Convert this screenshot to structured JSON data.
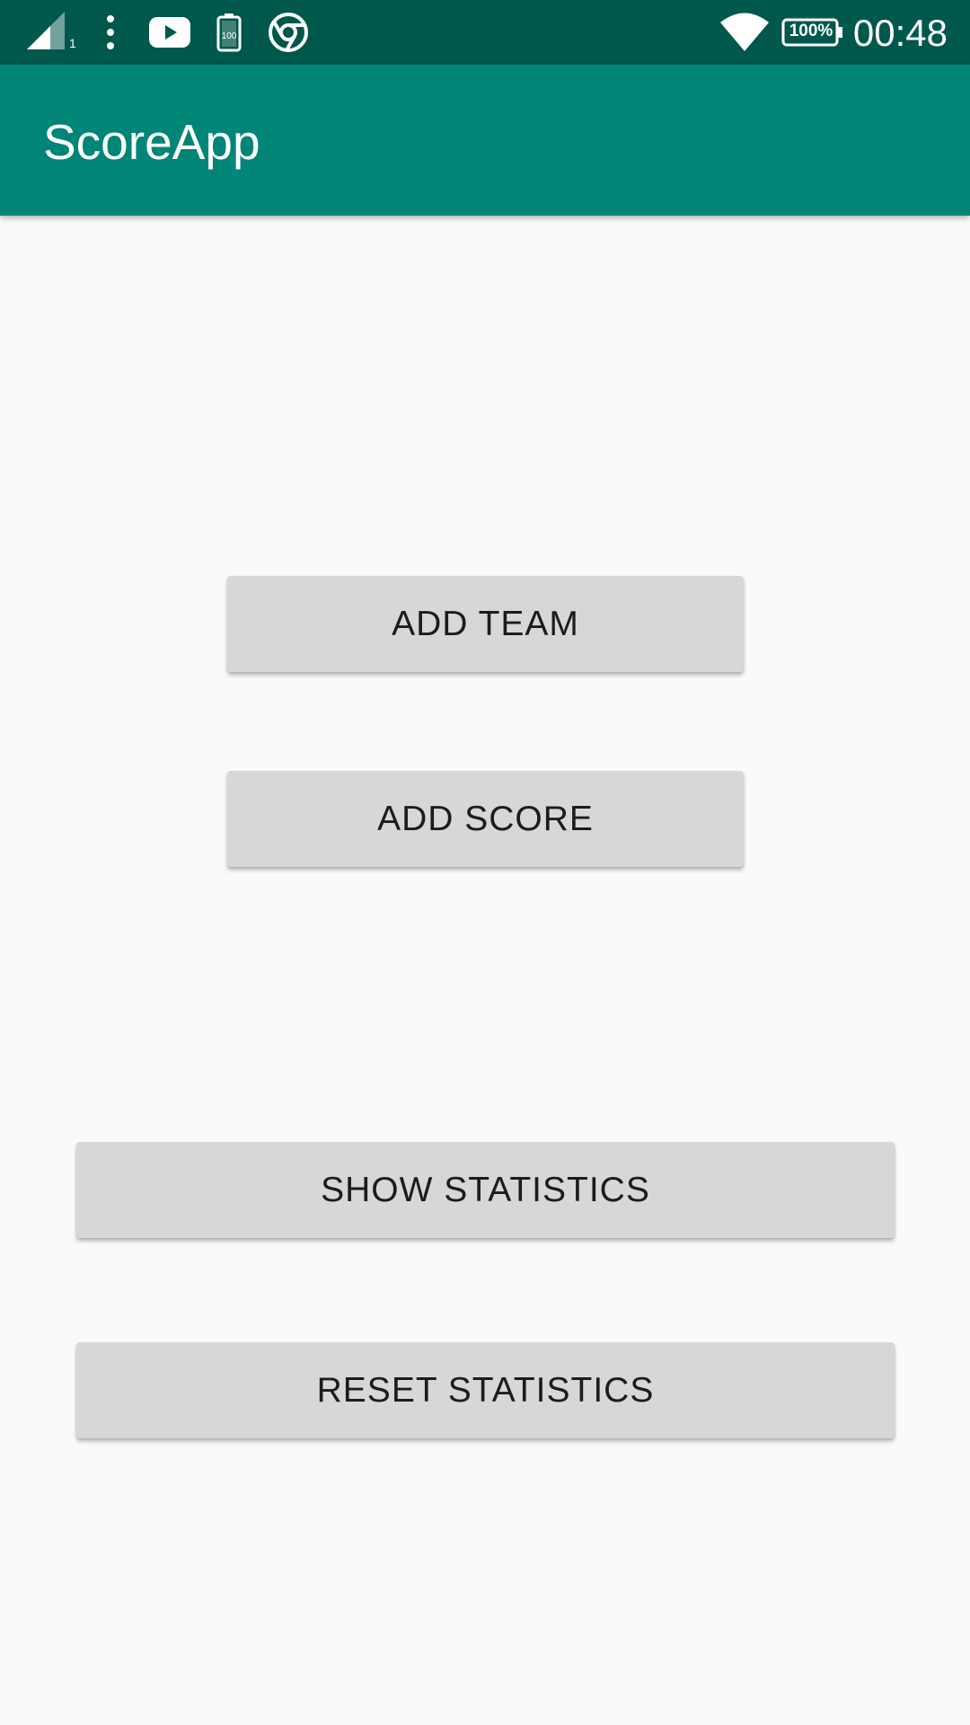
{
  "status_bar": {
    "time": "00:48",
    "battery_percent": "100%",
    "battery_saver_level": "100",
    "sim_slot": "1",
    "icons": [
      "signal-icon",
      "more-vert-icon",
      "youtube-icon",
      "battery-saver-icon",
      "chrome-icon",
      "wifi-icon",
      "battery-icon"
    ],
    "background_color": "#00574b"
  },
  "app_bar": {
    "title": "ScoreApp",
    "background_color": "#008577"
  },
  "buttons": {
    "add_team": "ADD TEAM",
    "add_score": "ADD SCORE",
    "show_statistics": "SHOW STATISTICS",
    "reset_statistics": "RESET STATISTICS"
  }
}
